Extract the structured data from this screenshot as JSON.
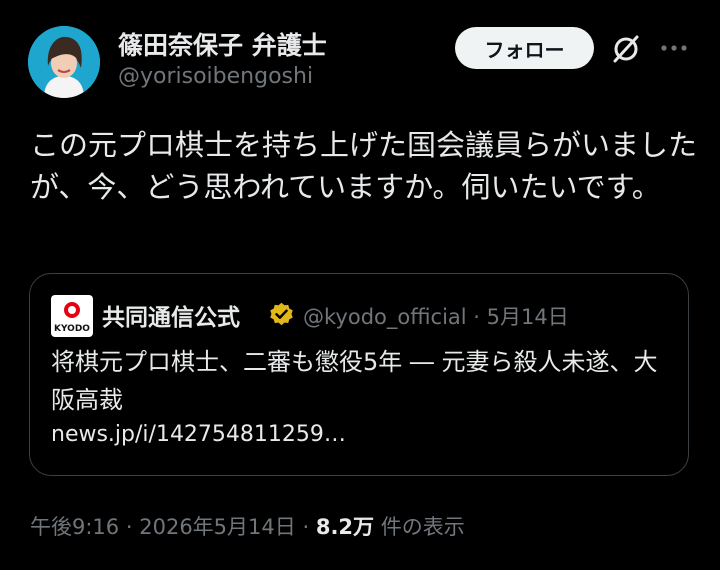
{
  "author": {
    "display_name": "篠田奈保子 弁護士",
    "handle": "@yorisoibengoshi",
    "avatar": "avatar"
  },
  "actions": {
    "follow_label": "フォロー",
    "grok_icon": "grok-slash-icon",
    "more_icon": "more-dots-icon"
  },
  "post": {
    "text": "この元プロ棋士を持ち上げた国会議員らがいましたが、今、どう思われていますか。伺いたいです。"
  },
  "quote": {
    "logo_text": "KYODO",
    "display_name": "共同通信公式",
    "verified_icon": "gold-verified-badge-icon",
    "handle": "@kyodo_official",
    "separator": "·",
    "date": "5月14日",
    "text": "将棋元プロ棋士、二審も懲役5年 ― 元妻ら殺人未遂、大阪高裁",
    "link": "news.jp/i/142754811259…"
  },
  "footer": {
    "time": "午後9:16",
    "sep1": "·",
    "date": "2026年5月14日",
    "sep2": "·",
    "views_count": "8.2万",
    "views_label": "件の表示"
  },
  "colors": {
    "background": "#000000",
    "text": "#e7e9ea",
    "muted": "#71767b",
    "button_bg": "#eff3f4",
    "verified_gold": "#e2b719",
    "kyodo_red": "#e60012"
  }
}
